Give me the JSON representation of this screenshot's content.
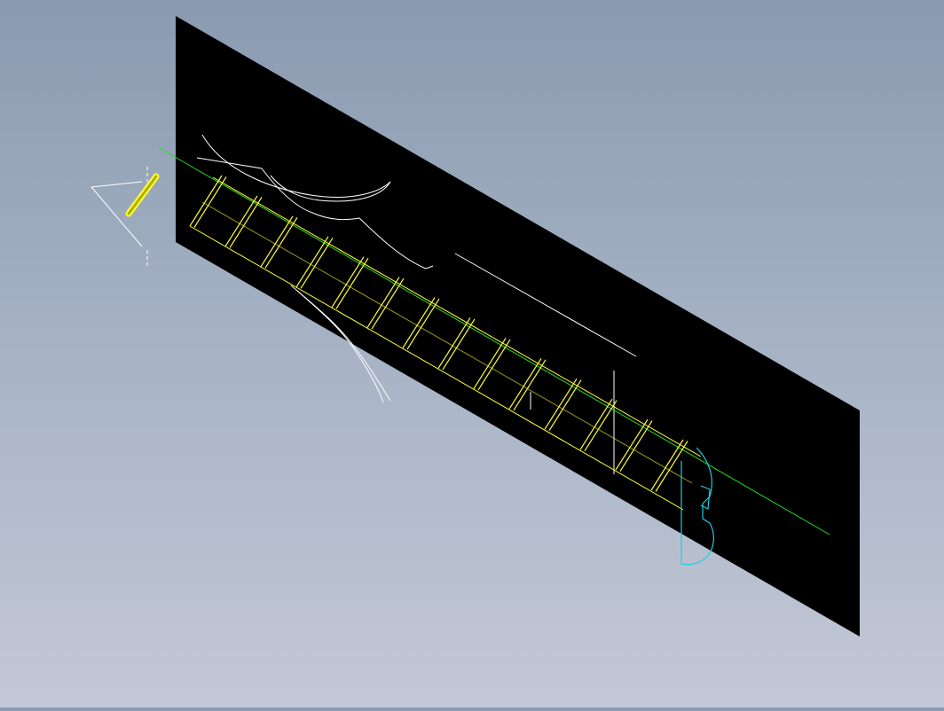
{
  "viewport": {
    "background_top": "#8a9ab0",
    "background_bottom": "#c3c8d6"
  },
  "drawing": {
    "plane_color": "#000000",
    "screw_color": "#ffff33",
    "axis_color": "#22dd22",
    "sketch_color": "#ffffff",
    "profile_color": "#22ccdd",
    "icons": {
      "view_triad": "coordinate-triad-icon",
      "pin": "pin-part-icon"
    },
    "screw_flight_count": 14
  }
}
